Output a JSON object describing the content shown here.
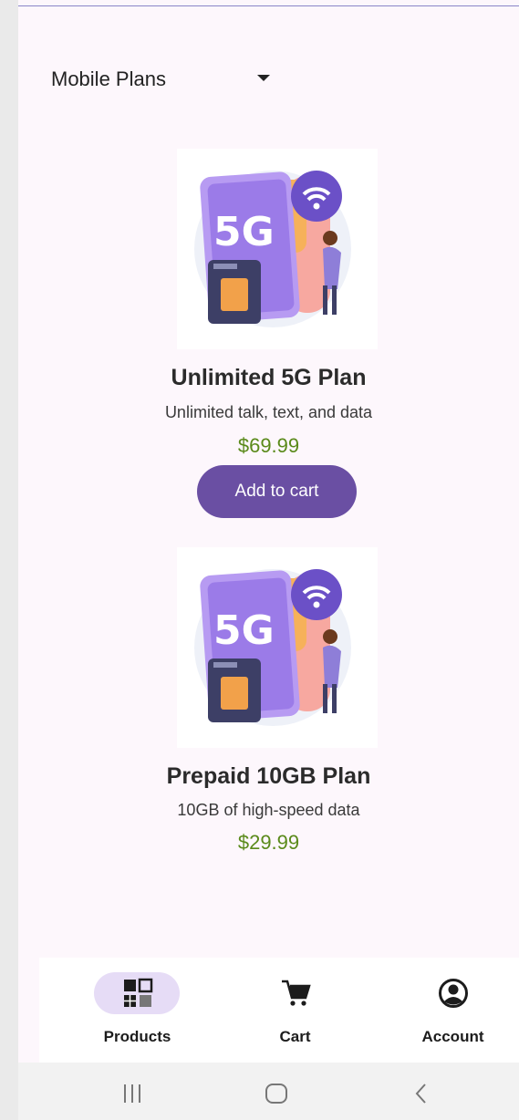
{
  "category_select": {
    "selected": "Mobile Plans"
  },
  "products": [
    {
      "name": "Unlimited 5G Plan",
      "description": "Unlimited talk, text, and data",
      "price": "$69.99",
      "image_icon": "5g-phone-sim-illustration",
      "image_text": "5G",
      "button_label": "Add to cart"
    },
    {
      "name": "Prepaid 10GB Plan",
      "description": "10GB of high-speed data",
      "price": "$29.99",
      "image_icon": "5g-phone-sim-illustration",
      "image_text": "5G"
    }
  ],
  "bottom_nav": {
    "items": [
      {
        "label": "Products",
        "icon": "products-grid-icon",
        "active": true
      },
      {
        "label": "Cart",
        "icon": "cart-icon",
        "active": false
      },
      {
        "label": "Account",
        "icon": "account-icon",
        "active": false
      }
    ]
  },
  "system_nav": {
    "items": [
      "recent-apps-icon",
      "home-icon",
      "back-icon"
    ]
  },
  "colors": {
    "accent": "#6a4fa3",
    "price": "#5a8a1a",
    "active_pill": "#e6dcf6",
    "background": "#fdf7fc"
  }
}
